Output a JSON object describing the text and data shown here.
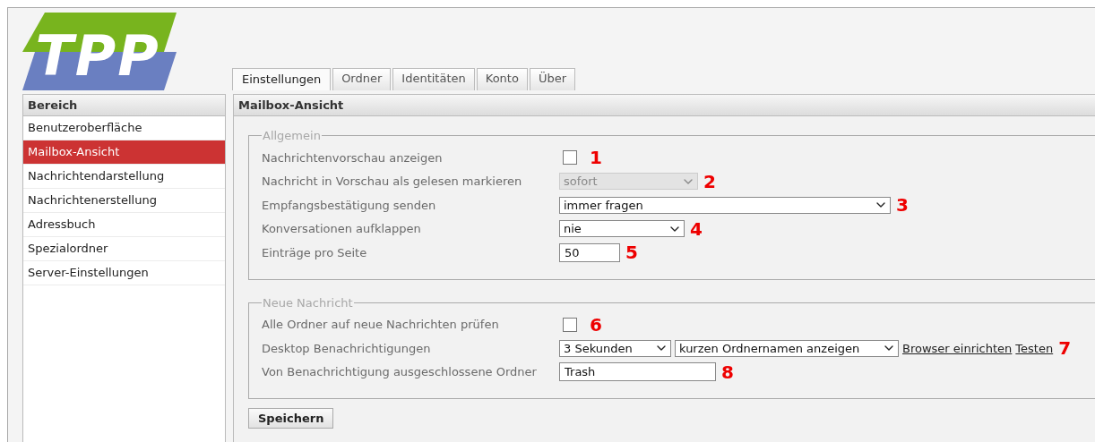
{
  "logo": "TPP",
  "tabs": [
    {
      "label": "Einstellungen",
      "selected": true
    },
    {
      "label": "Ordner",
      "selected": false
    },
    {
      "label": "Identitäten",
      "selected": false
    },
    {
      "label": "Konto",
      "selected": false
    },
    {
      "label": "Über",
      "selected": false
    }
  ],
  "sidebar": {
    "title": "Bereich",
    "items": [
      {
        "label": "Benutzeroberfläche",
        "selected": false
      },
      {
        "label": "Mailbox-Ansicht",
        "selected": true
      },
      {
        "label": "Nachrichtendarstellung",
        "selected": false
      },
      {
        "label": "Nachrichtenerstellung",
        "selected": false
      },
      {
        "label": "Adressbuch",
        "selected": false
      },
      {
        "label": "Spezialordner",
        "selected": false
      },
      {
        "label": "Server-Einstellungen",
        "selected": false
      }
    ]
  },
  "panel": {
    "title": "Mailbox-Ansicht",
    "sections": [
      {
        "legend": "Allgemein",
        "rows": [
          {
            "label": "Nachrichtenvorschau anzeigen",
            "marker": "1",
            "controls": [
              {
                "kind": "checkbox",
                "checked": false
              }
            ]
          },
          {
            "label": "Nachricht in Vorschau als gelesen markieren",
            "marker": "2",
            "controls": [
              {
                "kind": "select",
                "value": "sofort",
                "disabled": true
              }
            ]
          },
          {
            "label": "Empfangsbestätigung senden",
            "marker": "3",
            "controls": [
              {
                "kind": "select",
                "value": "immer fragen",
                "disabled": false
              }
            ]
          },
          {
            "label": "Konversationen aufklappen",
            "marker": "4",
            "controls": [
              {
                "kind": "select",
                "value": "nie",
                "disabled": false
              }
            ]
          },
          {
            "label": "Einträge pro Seite",
            "marker": "5",
            "controls": [
              {
                "kind": "text",
                "value": "50"
              }
            ]
          }
        ]
      },
      {
        "legend": "Neue Nachricht",
        "rows": [
          {
            "label": "Alle Ordner auf neue Nachrichten prüfen",
            "marker": "6",
            "controls": [
              {
                "kind": "checkbox",
                "checked": false
              }
            ]
          },
          {
            "label": "Desktop Benachrichtigungen",
            "marker": "7",
            "controls": [
              {
                "kind": "select",
                "value": "3 Sekunden",
                "disabled": false
              },
              {
                "kind": "select",
                "value": "kurzen Ordnernamen anzeigen",
                "disabled": false
              },
              {
                "kind": "link",
                "text": "Browser einrichten"
              },
              {
                "kind": "link",
                "text": "Testen"
              }
            ]
          },
          {
            "label": "Von Benachrichtigung ausgeschlossene Ordner",
            "marker": "8",
            "controls": [
              {
                "kind": "text",
                "value": "Trash"
              }
            ]
          }
        ]
      }
    ],
    "save_button": "Speichern"
  }
}
